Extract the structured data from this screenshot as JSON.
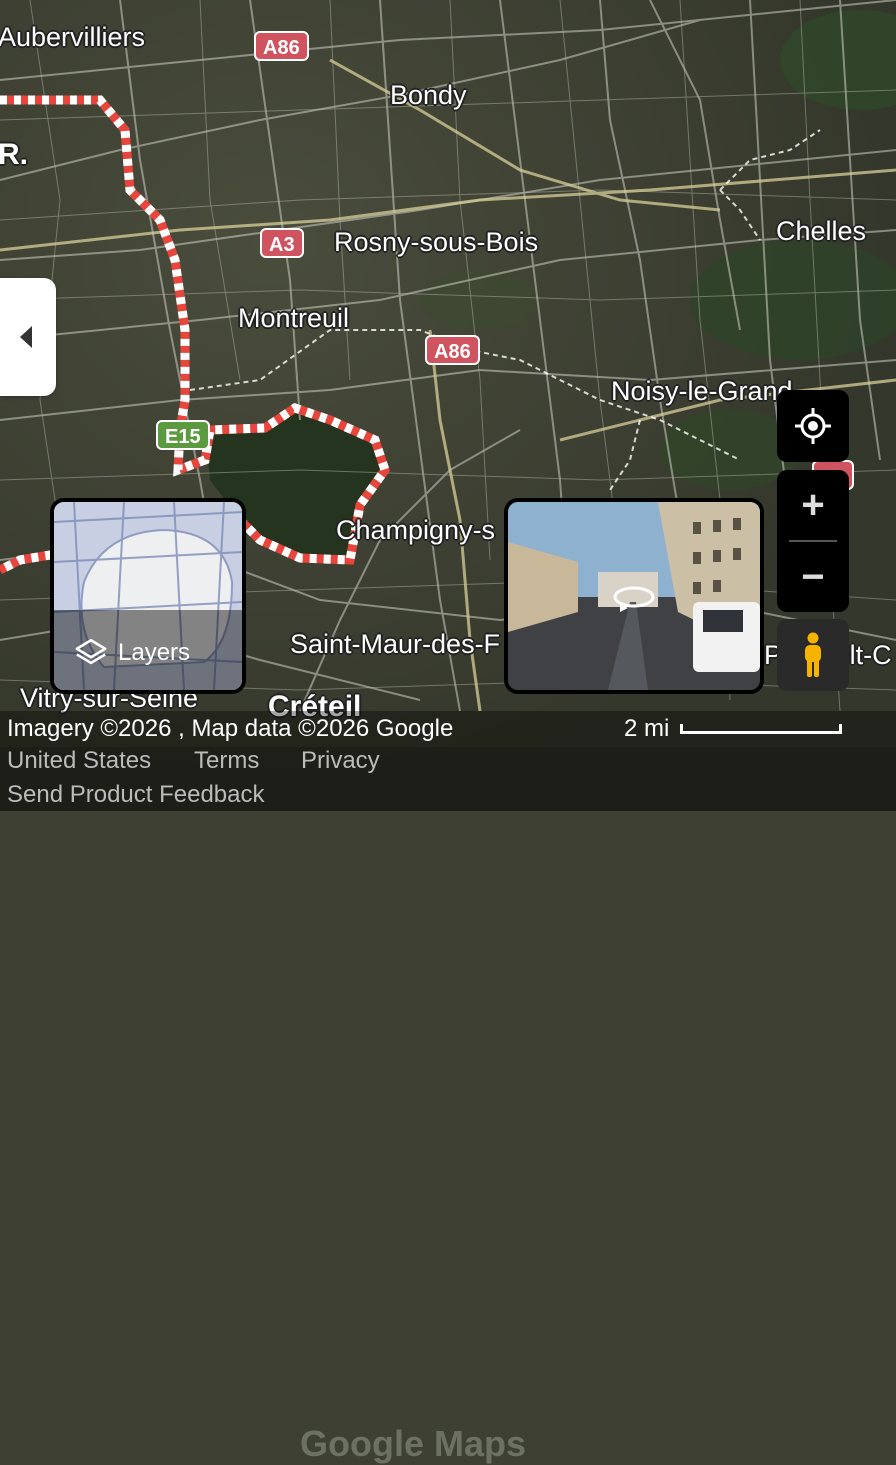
{
  "places": {
    "aubervilliers": "Aubervilliers",
    "bondy": "Bondy",
    "paris_fragment": "R.",
    "rosny": "Rosny-sous-Bois",
    "chelles": "Chelles",
    "montreuil": "Montreuil",
    "noisy": "Noisy-le-Grand",
    "champigny": "Champigny-s",
    "saint_maur": "Saint-Maur-des-F",
    "vitry": "Vitry-sur-Seine",
    "creteil": "Créteil",
    "pontault": "Pontault-C"
  },
  "shields": {
    "a86_top": "A86",
    "a3": "A3",
    "a86_mid": "A86",
    "e15": "E15"
  },
  "controls": {
    "layers_label": "Layers",
    "zoom_in": "+",
    "zoom_out": "−"
  },
  "footer": {
    "attribution": "Imagery ©2026 , Map data ©2026 Google",
    "watermark": "Google Maps",
    "scale_label": "2 mi",
    "links": {
      "country": "United States",
      "terms": "Terms",
      "privacy": "Privacy",
      "feedback": "Send Product Feedback"
    }
  },
  "colors": {
    "boundary_red": "#e8453c",
    "shield_red": "#d0545f",
    "shield_green": "#5c9a40"
  },
  "icons": {
    "collapse": "chevron-left-icon",
    "layers": "layers-icon",
    "location": "my-location-icon",
    "pegman": "pegman-icon",
    "rotate": "rotate-360-icon"
  }
}
